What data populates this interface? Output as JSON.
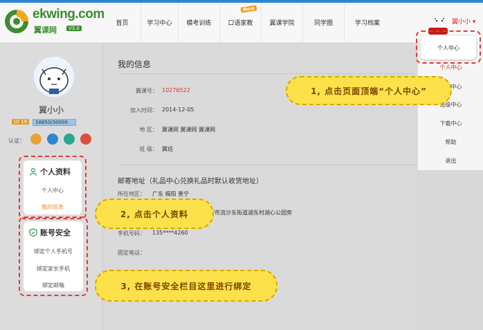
{
  "brand": {
    "logo_text": "ekwing.com",
    "logo_cn": "翼课网",
    "version": "V3.0"
  },
  "nav": {
    "items": [
      "首页",
      "学习中心",
      "模考训练",
      "口语家教",
      "翼课学院",
      "同学圈",
      "学习档案"
    ],
    "new_badge": "New",
    "user_name": "翼小小"
  },
  "profile": {
    "nickname": "翼小小",
    "level": "LV 19",
    "exp": "18850/30000",
    "cert_label": "认证："
  },
  "sidebar": {
    "personal_title": "个人资料",
    "personal_links": [
      "个人中心",
      "我的信息"
    ],
    "security_title": "账号安全",
    "security_links": [
      "绑定个人手机号",
      "绑定家长手机",
      "绑定邮箱"
    ]
  },
  "info": {
    "title": "我的信息",
    "rows": [
      {
        "label": "翼课号：",
        "value": "10276522"
      },
      {
        "label": "加入时间：",
        "value": "2014-12-05"
      },
      {
        "label": "地  区：",
        "value": "翼课网 翼课网 翼课网"
      },
      {
        "label": "班  级：",
        "value": "翼班"
      }
    ],
    "address_title": "邮寄地址（礼品中心兑换礼品时默认收货地址）",
    "addr_rows": [
      {
        "label": "所在地区：",
        "value": "广东 揭阳 普宁"
      },
      {
        "label": "",
        "value": "宁市流沙东街道湖东村湖心公园旁"
      },
      {
        "label": "手机号码：",
        "value": "135****4260"
      },
      {
        "label": "固定电话：",
        "value": ""
      }
    ]
  },
  "dropdown": {
    "popup_item": "个人中心",
    "items": [
      "个人中心",
      "学习中心",
      "班级中心",
      "下载中心",
      "帮助",
      "退出"
    ]
  },
  "callouts": {
    "step1": "1, 点击页面顶端“个人中心”",
    "step2": "2, 点击个人资料",
    "step3": "3, 在账号安全栏目这里进行绑定"
  },
  "colors": {
    "brand_green": "#3c8d2f",
    "accent_orange": "#f08a1b",
    "callout_yellow": "#fde14a",
    "highlight_red": "#e23838"
  }
}
